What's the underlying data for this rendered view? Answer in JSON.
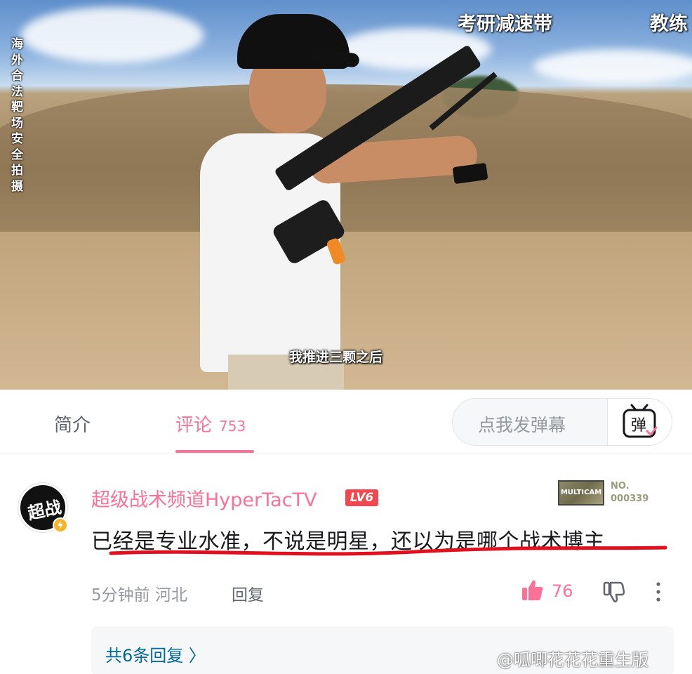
{
  "video": {
    "side_caption": "海外合法靶场安全拍摄",
    "banner_left": "考研减速带",
    "banner_right": "教练",
    "subtitle": "我推进三颗之后"
  },
  "tabs": {
    "intro": "简介",
    "comments": "评论",
    "comments_count": "753",
    "danmaku_placeholder": "点我发弹幕",
    "danmaku_icon_label": "弹"
  },
  "comment": {
    "avatar_text": "超战",
    "username": "超级战术频道HyperTacTV",
    "level": "LV6",
    "badge_image_text": "MULTICAM",
    "badge_no_label": "NO.",
    "badge_no_value": "000339",
    "text": "已经是专业水准，不说是明星，还以为是哪个战术博主",
    "time_location": "5分钟前 河北",
    "reply_label": "回复",
    "like_count": "76",
    "replies_link": "共6条回复 〉"
  },
  "watermark": "@呱唧花花花重生版",
  "colors": {
    "accent_pink": "#fb7299",
    "link_blue": "#00699d",
    "underline_red": "#e0101e"
  }
}
